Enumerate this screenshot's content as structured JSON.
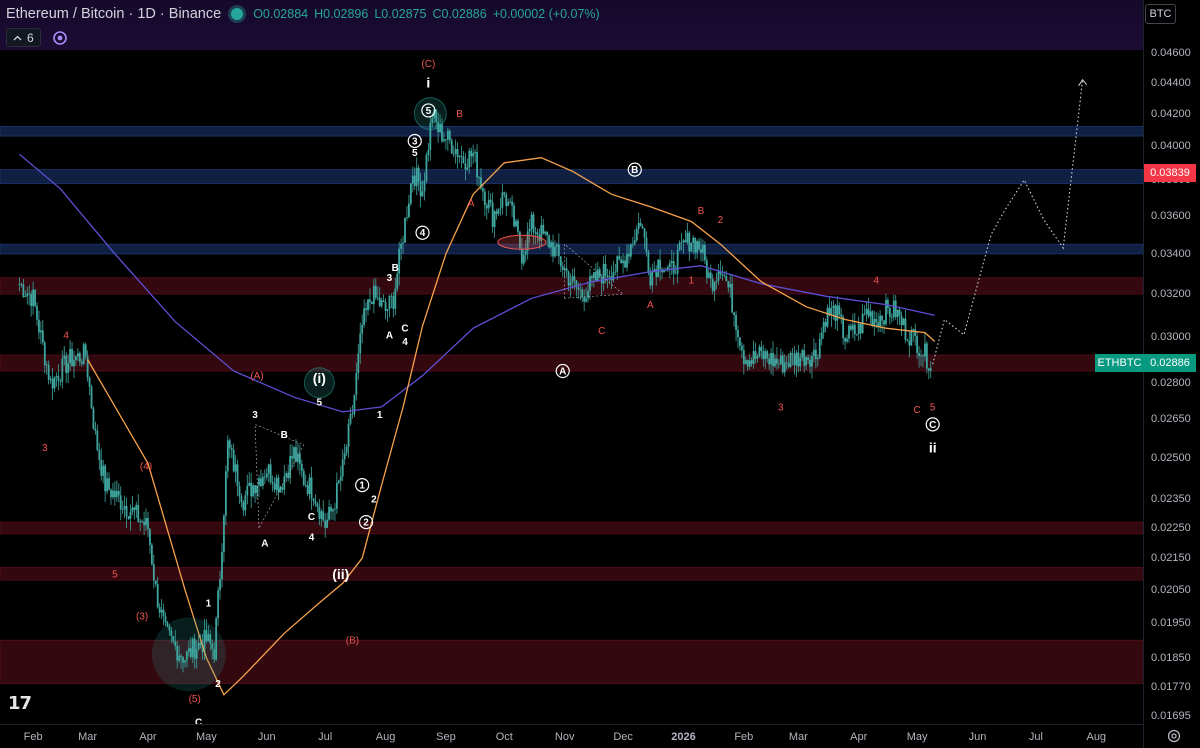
{
  "header": {
    "title": "Ethereum / Bitcoin · 1D · Binance",
    "open": "O0.02884",
    "high": "H0.02896",
    "low": "L0.02875",
    "close": "C0.02886",
    "change": "+0.00002 (+0.07%)",
    "indicator_count": "6"
  },
  "currency_button": "BTC",
  "symbol_badge": "ETHBTC",
  "logo_text": "17",
  "colors": {
    "up": "#26a69a",
    "down": "#ef5350",
    "candle": "#3fa7a0",
    "ma_orange": "#f7a24b",
    "ma_purple": "#5e4fd4",
    "zone_blue": "#1e3a78",
    "zone_red": "#5c0f1c",
    "wave_red": "#ef5350",
    "wave_white": "#ffffff"
  },
  "chart_data": {
    "type": "line",
    "instrument": "ETHBTC",
    "timeframe": "1D",
    "y_axis": {
      "scale": "log",
      "ticks": [
        "0.04600",
        "0.04400",
        "0.04200",
        "0.04000",
        "0.03800",
        "0.03600",
        "0.03400",
        "0.03200",
        "0.03000",
        "0.02800",
        "0.02650",
        "0.02500",
        "0.02350",
        "0.02250",
        "0.02150",
        "0.02050",
        "0.01950",
        "0.01850",
        "0.01770",
        "0.01695"
      ],
      "range": [
        0.0169,
        0.0465
      ],
      "last_price": "0.02886",
      "marked_price": "0.03839"
    },
    "x_axis": {
      "ticks": [
        "Feb",
        "Mar",
        "Apr",
        "May",
        "Jun",
        "Jul",
        "Aug",
        "Sep",
        "Oct",
        "Nov",
        "Dec",
        "2026",
        "Feb",
        "Mar",
        "Apr",
        "May",
        "Jun",
        "Jul",
        "Aug"
      ]
    },
    "series": [
      {
        "kind": "candles",
        "points": [
          [
            "2025-01-25",
            0.0325
          ],
          [
            "2025-02-01",
            0.0318
          ],
          [
            "2025-02-05",
            0.03
          ],
          [
            "2025-02-10",
            0.028
          ],
          [
            "2025-02-20",
            0.029
          ],
          [
            "2025-02-28",
            0.0292
          ],
          [
            "2025-03-05",
            0.0258
          ],
          [
            "2025-03-10",
            0.024
          ],
          [
            "2025-03-20",
            0.0233
          ],
          [
            "2025-03-25",
            0.023
          ],
          [
            "2025-04-01",
            0.0225
          ],
          [
            "2025-04-05",
            0.0205
          ],
          [
            "2025-04-10",
            0.0192
          ],
          [
            "2025-04-15",
            0.0188
          ],
          [
            "2025-04-20",
            0.0185
          ],
          [
            "2025-04-25",
            0.0188
          ],
          [
            "2025-05-01",
            0.019
          ],
          [
            "2025-05-05",
            0.0187
          ],
          [
            "2025-05-08",
            0.021
          ],
          [
            "2025-05-10",
            0.0232
          ],
          [
            "2025-05-12",
            0.0255
          ],
          [
            "2025-05-20",
            0.0235
          ],
          [
            "2025-05-25",
            0.024
          ],
          [
            "2025-06-01",
            0.0246
          ],
          [
            "2025-06-08",
            0.024
          ],
          [
            "2025-06-15",
            0.0252
          ],
          [
            "2025-06-20",
            0.0242
          ],
          [
            "2025-06-25",
            0.0238
          ],
          [
            "2025-07-01",
            0.0226
          ],
          [
            "2025-07-05",
            0.0232
          ],
          [
            "2025-07-10",
            0.0246
          ],
          [
            "2025-07-15",
            0.0268
          ],
          [
            "2025-07-20",
            0.0305
          ],
          [
            "2025-07-25",
            0.032
          ],
          [
            "2025-08-01",
            0.0312
          ],
          [
            "2025-08-05",
            0.0318
          ],
          [
            "2025-08-10",
            0.035
          ],
          [
            "2025-08-15",
            0.0385
          ],
          [
            "2025-08-20",
            0.0375
          ],
          [
            "2025-08-25",
            0.042
          ],
          [
            "2025-08-28",
            0.041
          ],
          [
            "2025-09-05",
            0.04
          ],
          [
            "2025-09-10",
            0.0392
          ],
          [
            "2025-09-15",
            0.0395
          ],
          [
            "2025-09-20",
            0.0375
          ],
          [
            "2025-09-25",
            0.036
          ],
          [
            "2025-10-01",
            0.0372
          ],
          [
            "2025-10-05",
            0.036
          ],
          [
            "2025-10-10",
            0.034
          ],
          [
            "2025-10-15",
            0.0355
          ],
          [
            "2025-10-20",
            0.035
          ],
          [
            "2025-10-25",
            0.0345
          ],
          [
            "2025-11-01",
            0.0332
          ],
          [
            "2025-11-05",
            0.0325
          ],
          [
            "2025-11-10",
            0.032
          ],
          [
            "2025-11-20",
            0.033
          ],
          [
            "2025-11-30",
            0.0334
          ],
          [
            "2025-12-05",
            0.0345
          ],
          [
            "2025-12-10",
            0.0358
          ],
          [
            "2025-12-15",
            0.033
          ],
          [
            "2025-12-20",
            0.0337
          ],
          [
            "2025-12-25",
            0.033
          ],
          [
            "2026-01-01",
            0.0344
          ],
          [
            "2026-01-05",
            0.0348
          ],
          [
            "2026-01-10",
            0.0343
          ],
          [
            "2026-01-15",
            0.0325
          ],
          [
            "2026-01-20",
            0.0335
          ],
          [
            "2026-01-25",
            0.032
          ],
          [
            "2026-02-01",
            0.0292
          ],
          [
            "2026-02-05",
            0.029
          ],
          [
            "2026-02-10",
            0.0292
          ],
          [
            "2026-02-20",
            0.0288
          ],
          [
            "2026-02-25",
            0.029
          ],
          [
            "2026-03-05",
            0.0292
          ],
          [
            "2026-03-10",
            0.0292
          ],
          [
            "2026-03-15",
            0.031
          ],
          [
            "2026-03-20",
            0.0312
          ],
          [
            "2026-03-25",
            0.03
          ],
          [
            "2026-04-01",
            0.0303
          ],
          [
            "2026-04-05",
            0.0312
          ],
          [
            "2026-04-10",
            0.0308
          ],
          [
            "2026-04-15",
            0.0312
          ],
          [
            "2026-04-20",
            0.0312
          ],
          [
            "2026-04-25",
            0.0303
          ],
          [
            "2026-05-01",
            0.0298
          ],
          [
            "2026-05-05",
            0.0292
          ],
          [
            "2026-05-09",
            0.0288
          ]
        ]
      },
      {
        "kind": "ma_orange",
        "points": [
          [
            "2025-03-01",
            0.029
          ],
          [
            "2025-04-01",
            0.0248
          ],
          [
            "2025-04-20",
            0.0205
          ],
          [
            "2025-05-01",
            0.0185
          ],
          [
            "2025-05-10",
            0.0175
          ],
          [
            "2025-05-20",
            0.018
          ],
          [
            "2025-06-10",
            0.0192
          ],
          [
            "2025-06-28",
            0.0201
          ],
          [
            "2025-07-10",
            0.0207
          ],
          [
            "2025-07-20",
            0.0215
          ],
          [
            "2025-07-30",
            0.024
          ],
          [
            "2025-08-10",
            0.027
          ],
          [
            "2025-08-20",
            0.0305
          ],
          [
            "2025-09-01",
            0.034
          ],
          [
            "2025-09-15",
            0.0372
          ],
          [
            "2025-10-01",
            0.039
          ],
          [
            "2025-10-20",
            0.0393
          ],
          [
            "2025-11-05",
            0.0385
          ],
          [
            "2025-11-25",
            0.0372
          ],
          [
            "2025-12-15",
            0.0365
          ],
          [
            "2026-01-05",
            0.0357
          ],
          [
            "2026-01-20",
            0.0345
          ],
          [
            "2026-02-10",
            0.0326
          ],
          [
            "2026-03-05",
            0.0314
          ],
          [
            "2026-03-25",
            0.0308
          ],
          [
            "2026-04-15",
            0.0304
          ],
          [
            "2026-05-05",
            0.0302
          ],
          [
            "2026-05-10",
            0.0298
          ]
        ]
      },
      {
        "kind": "ma_purple",
        "points": [
          [
            "2025-01-25",
            0.0395
          ],
          [
            "2025-02-15",
            0.0375
          ],
          [
            "2025-03-15",
            0.034
          ],
          [
            "2025-04-15",
            0.0307
          ],
          [
            "2025-05-15",
            0.0285
          ],
          [
            "2025-06-15",
            0.0274
          ],
          [
            "2025-07-10",
            0.0268
          ],
          [
            "2025-07-30",
            0.027
          ],
          [
            "2025-08-20",
            0.0283
          ],
          [
            "2025-09-15",
            0.0304
          ],
          [
            "2025-10-15",
            0.0318
          ],
          [
            "2025-11-15",
            0.0326
          ],
          [
            "2025-12-15",
            0.0331
          ],
          [
            "2026-01-10",
            0.0334
          ],
          [
            "2026-02-10",
            0.0325
          ],
          [
            "2026-03-15",
            0.0319
          ],
          [
            "2026-04-15",
            0.0315
          ],
          [
            "2026-05-10",
            0.031
          ]
        ]
      },
      {
        "kind": "projection",
        "points": [
          [
            "2026-05-09",
            0.0288
          ],
          [
            "2026-05-15",
            0.0308
          ],
          [
            "2026-05-25",
            0.0301
          ],
          [
            "2026-06-08",
            0.035
          ],
          [
            "2026-06-15",
            0.0363
          ],
          [
            "2026-06-25",
            0.038
          ],
          [
            "2026-07-05",
            0.0358
          ],
          [
            "2026-07-15",
            0.0343
          ],
          [
            "2026-07-25",
            0.0442
          ]
        ]
      }
    ],
    "zones": [
      {
        "color": "blue",
        "from": 0.0406,
        "to": 0.0412
      },
      {
        "color": "blue",
        "from": 0.0378,
        "to": 0.0386
      },
      {
        "color": "blue",
        "from": 0.034,
        "to": 0.0345
      },
      {
        "color": "red",
        "from": 0.032,
        "to": 0.0328
      },
      {
        "color": "red",
        "from": 0.0285,
        "to": 0.0292
      },
      {
        "color": "red",
        "from": 0.0223,
        "to": 0.0227
      },
      {
        "color": "red",
        "from": 0.0208,
        "to": 0.0212
      },
      {
        "color": "red",
        "from": 0.0178,
        "to": 0.019
      }
    ],
    "annotations": [
      {
        "text": "(C)",
        "color": "red",
        "t": "2025-08-23",
        "p": 0.0453
      },
      {
        "text": "i",
        "color": "white",
        "t": "2025-08-23",
        "p": 0.044
      },
      {
        "text": "5",
        "color": "white",
        "t": "2025-08-23",
        "p": 0.0422,
        "circled": true
      },
      {
        "text": "B",
        "color": "red",
        "t": "2025-09-08",
        "p": 0.042
      },
      {
        "text": "3",
        "color": "white",
        "t": "2025-08-16",
        "p": 0.0403,
        "circled": true
      },
      {
        "text": "5",
        "color": "white",
        "t": "2025-08-16",
        "p": 0.0396
      },
      {
        "text": "A",
        "color": "red",
        "t": "2025-09-14",
        "p": 0.0367
      },
      {
        "text": "4",
        "color": "white",
        "t": "2025-08-20",
        "p": 0.0351,
        "circled": true
      },
      {
        "text": "B",
        "color": "white",
        "t": "2025-12-07",
        "p": 0.0386,
        "circled": true
      },
      {
        "text": "B",
        "color": "red",
        "t": "2026-01-10",
        "p": 0.0363
      },
      {
        "text": "2",
        "color": "red",
        "t": "2026-01-20",
        "p": 0.0358
      },
      {
        "text": "1",
        "color": "red",
        "t": "2026-01-05",
        "p": 0.0327
      },
      {
        "text": "A",
        "color": "red",
        "t": "2025-12-15",
        "p": 0.0315
      },
      {
        "text": "C",
        "color": "red",
        "t": "2025-11-20",
        "p": 0.0303
      },
      {
        "text": "A",
        "color": "white",
        "t": "2025-10-31",
        "p": 0.0285,
        "circled": true
      },
      {
        "text": "4",
        "color": "red",
        "t": "2026-04-10",
        "p": 0.0327
      },
      {
        "text": "3",
        "color": "red",
        "t": "2026-02-20",
        "p": 0.027
      },
      {
        "text": "C",
        "color": "red",
        "t": "2026-05-01",
        "p": 0.0269
      },
      {
        "text": "5",
        "color": "red",
        "t": "2026-05-09",
        "p": 0.027
      },
      {
        "text": "C",
        "color": "white",
        "t": "2026-05-09",
        "p": 0.0263,
        "circled": true
      },
      {
        "text": "ii",
        "color": "white",
        "t": "2026-05-09",
        "p": 0.0254
      },
      {
        "text": "3",
        "color": "white",
        "t": "2025-08-03",
        "p": 0.0328
      },
      {
        "text": "B",
        "color": "white",
        "t": "2025-08-06",
        "p": 0.0333
      },
      {
        "text": "A",
        "color": "white",
        "t": "2025-08-03",
        "p": 0.0301
      },
      {
        "text": "C",
        "color": "white",
        "t": "2025-08-11",
        "p": 0.0304
      },
      {
        "text": "4",
        "color": "white",
        "t": "2025-08-11",
        "p": 0.0298
      },
      {
        "text": "1",
        "color": "white",
        "t": "2025-07-29",
        "p": 0.0267
      },
      {
        "text": "2",
        "color": "white",
        "t": "2025-07-26",
        "p": 0.0235
      },
      {
        "text": "1",
        "color": "white",
        "t": "2025-07-20",
        "p": 0.024,
        "circled": true
      },
      {
        "text": "2",
        "color": "white",
        "t": "2025-07-22",
        "p": 0.0227,
        "circled": true
      },
      {
        "text": "(i)",
        "color": "white",
        "t": "2025-06-28",
        "p": 0.0282
      },
      {
        "text": "5",
        "color": "white",
        "t": "2025-06-28",
        "p": 0.0272
      },
      {
        "text": "(A)",
        "color": "red",
        "t": "2025-05-27",
        "p": 0.0283
      },
      {
        "text": "3",
        "color": "white",
        "t": "2025-05-26",
        "p": 0.0267
      },
      {
        "text": "B",
        "color": "white",
        "t": "2025-06-10",
        "p": 0.0259
      },
      {
        "text": "C",
        "color": "white",
        "t": "2025-06-24",
        "p": 0.0229
      },
      {
        "text": "4",
        "color": "white",
        "t": "2025-06-24",
        "p": 0.0222
      },
      {
        "text": "A",
        "color": "white",
        "t": "2025-05-31",
        "p": 0.022
      },
      {
        "text": "(ii)",
        "color": "white",
        "t": "2025-07-09",
        "p": 0.021
      },
      {
        "text": "(B)",
        "color": "red",
        "t": "2025-07-15",
        "p": 0.019
      },
      {
        "text": "4",
        "color": "red",
        "t": "2025-02-18",
        "p": 0.0301
      },
      {
        "text": "3",
        "color": "red",
        "t": "2025-02-07",
        "p": 0.0254
      },
      {
        "text": "(4)",
        "color": "red",
        "t": "2025-03-31",
        "p": 0.0247
      },
      {
        "text": "5",
        "color": "red",
        "t": "2025-03-15",
        "p": 0.021
      },
      {
        "text": "(3)",
        "color": "red",
        "t": "2025-03-29",
        "p": 0.0197
      },
      {
        "text": "1",
        "color": "white",
        "t": "2025-05-02",
        "p": 0.0201
      },
      {
        "text": "2",
        "color": "white",
        "t": "2025-05-07",
        "p": 0.0178
      },
      {
        "text": "(5)",
        "color": "red",
        "t": "2025-04-25",
        "p": 0.0174
      },
      {
        "text": "C",
        "color": "white",
        "t": "2025-04-27",
        "p": 0.0168
      }
    ]
  }
}
